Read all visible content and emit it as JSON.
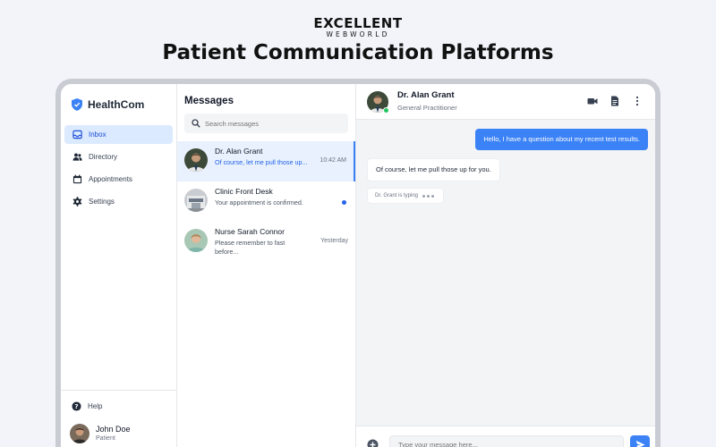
{
  "brand": {
    "name": "EXCELLENT",
    "tagline": "WEBWORLD"
  },
  "headline": "Patient Communication Platforms",
  "app": {
    "name": "HealthCom",
    "nav": [
      {
        "label": "Inbox",
        "icon": "inbox-icon",
        "active": true
      },
      {
        "label": "Directory",
        "icon": "people-icon"
      },
      {
        "label": "Appointments",
        "icon": "calendar-icon"
      },
      {
        "label": "Settings",
        "icon": "gear-icon"
      }
    ],
    "help_label": "Help",
    "user": {
      "name": "John Doe",
      "role": "Patient"
    }
  },
  "messages": {
    "title": "Messages",
    "search_placeholder": "Search messages",
    "threads": [
      {
        "name": "Dr. Alan Grant",
        "preview": "Of course, let me pull those up...",
        "time": "10:42 AM",
        "active": true
      },
      {
        "name": "Clinic Front Desk",
        "preview": "Your appointment is confirmed.",
        "time": "",
        "unread": true
      },
      {
        "name": "Nurse Sarah Connor",
        "preview": "Please remember to fast before...",
        "time": "Yesterday"
      }
    ]
  },
  "chat": {
    "contact_name": "Dr. Alan Grant",
    "contact_role": "General Practitioner",
    "messages": [
      {
        "direction": "out",
        "text": "Hello, I have a question about my recent test results."
      },
      {
        "direction": "in",
        "text": "Of course, let me pull those up for you."
      }
    ],
    "typing_text": "Dr. Grant is typing",
    "composer_placeholder": "Type your message here..."
  },
  "colors": {
    "accent": "#3b82f6",
    "active_bg": "#dbeafe",
    "online": "#22c55e"
  }
}
